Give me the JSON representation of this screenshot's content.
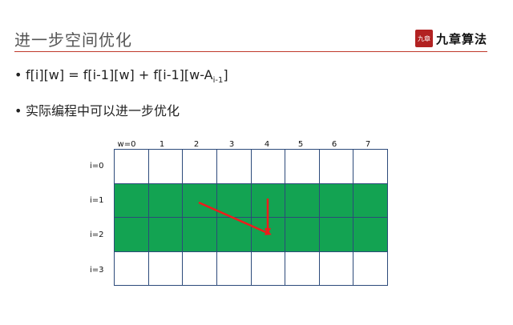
{
  "slide": {
    "title": "进一步空间优化",
    "logo": {
      "seal_text": "九章",
      "name": "九章算法"
    }
  },
  "bullets": [
    {
      "dot": "•",
      "text_main": "f[i][w] = f[i-1][w] + f[i-1][w-A",
      "text_sub": "i-1",
      "text_end": "]"
    },
    {
      "dot": "•",
      "text": "实际编程中可以进一步优化"
    }
  ],
  "table": {
    "column_labels": [
      "w=0",
      "1",
      "2",
      "3",
      "4",
      "5",
      "6",
      "7"
    ],
    "row_labels": [
      "i=0",
      "i=1",
      "i=2",
      "i=3"
    ],
    "highlighted_rows": [
      1,
      2
    ],
    "highlight_color": "#13a352",
    "border_color": "#2c4a7a",
    "arrow_color": "#ee1c1c"
  }
}
